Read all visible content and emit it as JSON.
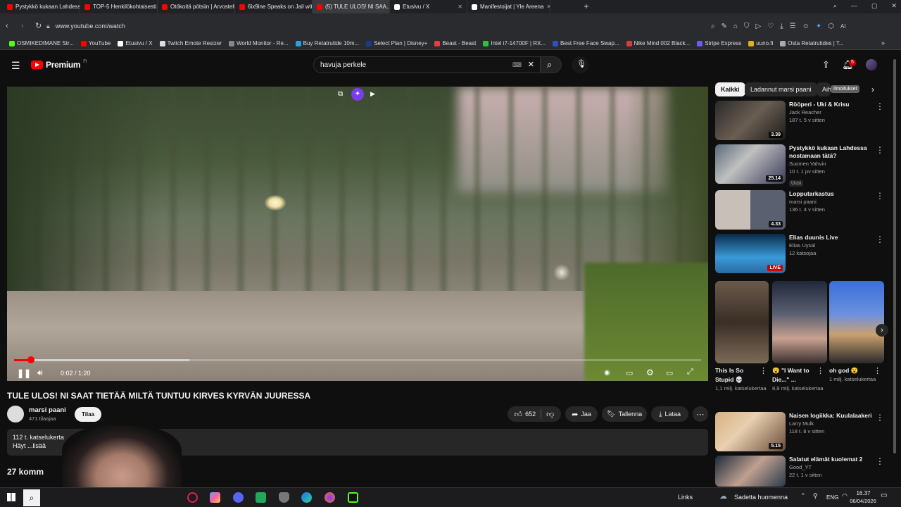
{
  "browser": {
    "tabs": [
      {
        "title": "Pystykkö kukaan Lahdessa...",
        "color": "#ff0000",
        "active": false
      },
      {
        "title": "TOP-5 Henkilökohtaisesti...",
        "color": "#ff0000",
        "active": false
      },
      {
        "title": "Otökoitä pötsiin | Arvosteltu...",
        "color": "#ff0000",
        "active": false
      },
      {
        "title": "6ix9ine Speaks on Jail with...",
        "color": "#ff0000",
        "active": false
      },
      {
        "title": "(5) TULE ULOS! NI SAA...",
        "color": "#ff0000",
        "active": true
      },
      {
        "title": "Etusivu / X",
        "color": "#ffffff",
        "active": false
      },
      {
        "title": "Manifestoijat | Yle Areena",
        "color": "#ffffff",
        "active": false
      }
    ],
    "new_tab_label": "+",
    "url": "www.youtube.com/watch",
    "bookmarks": [
      {
        "label": "OSMIKEDIMANE Str...",
        "color": "#53fc18"
      },
      {
        "label": "YouTube",
        "color": "#ff0000"
      },
      {
        "label": "Etusivu / X",
        "color": "#ffffff"
      },
      {
        "label": "Twitch Emote Resizer",
        "color": "#dddddd"
      },
      {
        "label": "World Monitor - Re...",
        "color": "#888888"
      },
      {
        "label": "Buy Retatrutide 10m...",
        "color": "#2aa0e0"
      },
      {
        "label": "Select Plan | Disney+",
        "color": "#1a3a8a"
      },
      {
        "label": "Beast - Beast",
        "color": "#e04040"
      },
      {
        "label": "Intel i7-14700F | RX...",
        "color": "#30c040"
      },
      {
        "label": "Best Free Face Swap...",
        "color": "#3050c0"
      },
      {
        "label": "Nike Mind 002 Black...",
        "color": "#d04040"
      },
      {
        "label": "Stripe Express",
        "color": "#6a5cf0"
      },
      {
        "label": "uuno.fi",
        "color": "#e0b020"
      },
      {
        "label": "Osta Retatrutides | T...",
        "color": "#aaaaaa"
      }
    ]
  },
  "youtube": {
    "logo_text": "Premium",
    "logo_sup": "FI",
    "search_value": "havuja perkele",
    "notification_count": "5",
    "notification_tooltip": "Ilmoitukset",
    "video": {
      "time": "0:02 / 1:20",
      "progress_fraction": 0.025,
      "buffered_fraction": 0.255,
      "title": "TULE ULOS! NI SAAT TIETÄÄ MILTÄ TUNTUU KIRVES KYRVÄN JUURESSA",
      "channel": "marsi paani",
      "subscribers": "471 tilaajaa",
      "subscribe_label": "Tilaa",
      "likes": "652",
      "share_label": "Jaa",
      "save_label": "Tallenna",
      "download_label": "Lataa",
      "views": "112 t. katselukerta",
      "desc_line": "Häyt ...lisää",
      "comments": "27 komm"
    },
    "chips": [
      "Kaikki",
      "Ladannut marsi paani",
      "Aih"
    ],
    "recommendations": [
      {
        "title": "Rööperi - Uki & Krisu",
        "channel": "Jack Reacher",
        "stats": "187 t.  5 v sitten",
        "duration": "3.39",
        "badge": ""
      },
      {
        "title": "Pystykkö kukaan Lahdessa nostamaan tätä?",
        "channel": "Suomen Vahvin",
        "stats": "10 t.  1 pv sitten",
        "duration": "25.14",
        "badge": "Uusi"
      },
      {
        "title": "Lopputarkastus",
        "channel": "marsi paani",
        "stats": "136 t.  4 v sitten",
        "duration": "4.33",
        "badge": ""
      },
      {
        "title": "Elias duunis Live",
        "channel": "Elias Uysal",
        "stats": "12 katsojaa",
        "duration": "LIVE",
        "badge": ""
      }
    ],
    "shorts": [
      {
        "title": "This Is So Stupid 💀",
        "views": "1,1 milj. katselukertaa"
      },
      {
        "title": "😮 \"I Want to Die...\" ...",
        "views": "8,9 milj. katselukertaa"
      },
      {
        "title": "oh god 😮",
        "views": "1 milj. katselukertaa"
      }
    ],
    "recommendations2": [
      {
        "title": "Naisen logiikka: Kuulalaakeri",
        "channel": "Larry Mulk",
        "stats": "118 t.  8 v sitten",
        "duration": "5.15"
      },
      {
        "title": "Salatut elämät kuolemat 2",
        "channel": "Good_YT",
        "stats": "22 t.  1 v sitten",
        "duration": ""
      }
    ]
  },
  "taskbar": {
    "links_label": "Links",
    "weather": "Sadetta huomenna",
    "lang": "ENG",
    "time": "16.37",
    "date": "06/04/2026"
  }
}
